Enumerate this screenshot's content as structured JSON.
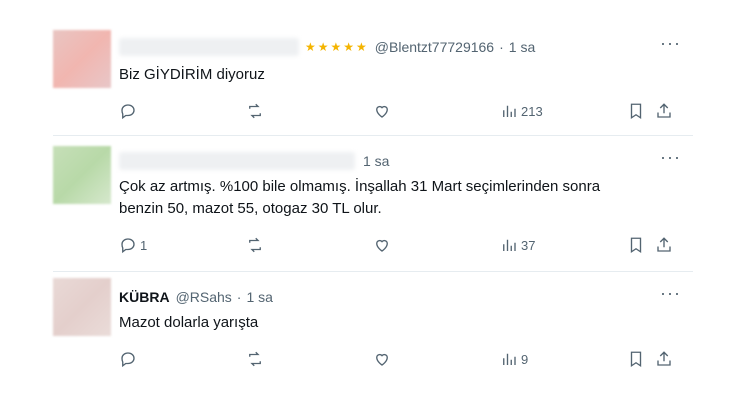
{
  "tweets": [
    {
      "display_name": "",
      "handle": "@Blentzt77729166",
      "separator": "·",
      "time": "1 sa",
      "text_lines": [
        "Biz GİYDİRİM diyoruz"
      ],
      "replies": "",
      "views": "213"
    },
    {
      "display_name": "",
      "handle": "",
      "separator": "",
      "time": "1 sa",
      "text_lines": [
        "Çok az artmış. %100 bile olmamış. İnşallah 31 Mart seçimlerinden sonra",
        "benzin 50, mazot 55, otogaz 30 TL olur."
      ],
      "replies": "1",
      "views": "37"
    },
    {
      "display_name": "KÜBRA",
      "handle": "@RSahs",
      "separator": "·",
      "time": "1 sa",
      "text_lines": [
        "Mazot dolarla yarışta"
      ],
      "replies": "",
      "views": "9"
    }
  ],
  "icons": {
    "more": "more-horizontal-icon",
    "reply": "reply-icon",
    "retweet": "retweet-icon",
    "like": "like-icon",
    "views": "views-icon",
    "bookmark": "bookmark-icon",
    "share": "share-icon"
  }
}
